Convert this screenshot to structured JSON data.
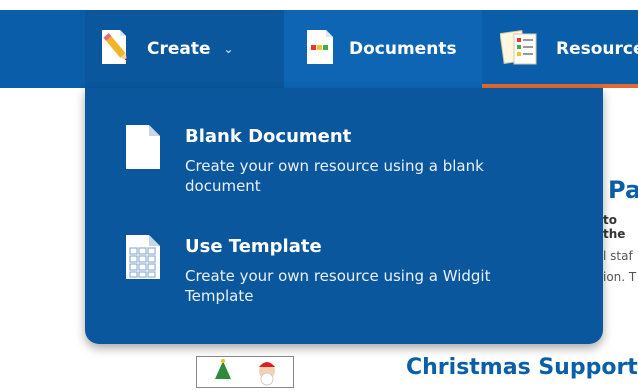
{
  "nav": {
    "create_label": "Create",
    "documents_label": "Documents",
    "resources_label": "Resources"
  },
  "dropdown": {
    "items": [
      {
        "title": "Blank Document",
        "description": "Create your own resource using a blank document",
        "icon": "blank-document-icon"
      },
      {
        "title": "Use Template",
        "description": "Create your own resource using a Widgit Template",
        "icon": "template-icon"
      }
    ]
  },
  "background": {
    "heading_fragment": "Pa",
    "subtitle_fragment": "to the",
    "text_fragment_1": "l staf",
    "text_fragment_2": "ion. T",
    "second_title": "Christmas Support"
  },
  "colors": {
    "nav_bg": "#0a5da8",
    "menu_bg": "#0b579d",
    "active_underline": "#e36b2f",
    "link_blue": "#0b5fa8"
  }
}
